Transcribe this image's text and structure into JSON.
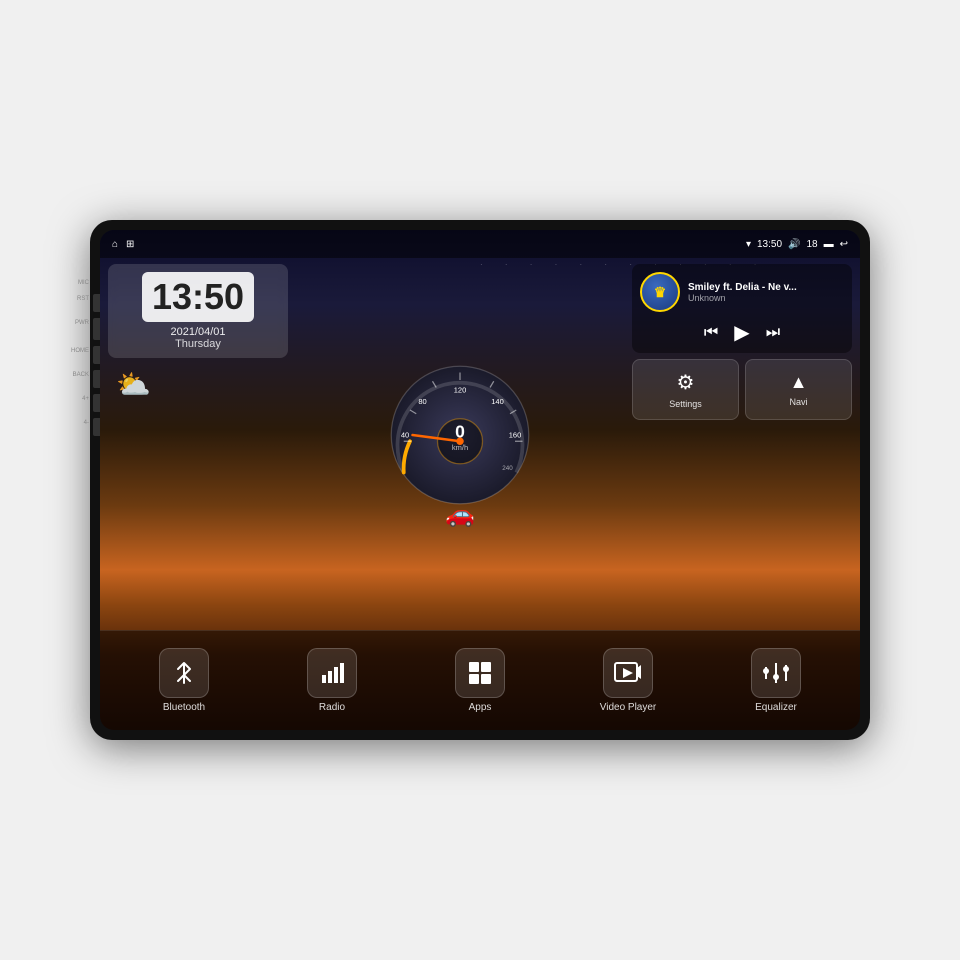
{
  "device": {
    "outer_bg": "#111"
  },
  "status_bar": {
    "wifi_icon": "wifi",
    "time": "13:50",
    "volume_icon": "volume",
    "volume_level": "18",
    "battery_icon": "battery",
    "back_icon": "back"
  },
  "nav_bar": {
    "home_icon": "⌂",
    "house_icon": "🏠"
  },
  "clock": {
    "time": "13:50",
    "date": "2021/04/01",
    "day": "Thursday"
  },
  "weather": {
    "icon": "⛅",
    "label": "Weather"
  },
  "speedometer": {
    "value": "0",
    "unit": "km/h",
    "max": "240"
  },
  "music": {
    "title": "Smiley ft. Delia - Ne v...",
    "artist": "Unknown",
    "prev_icon": "⏮",
    "play_icon": "▶",
    "next_icon": "⏭"
  },
  "quick_actions": [
    {
      "id": "settings",
      "icon": "⚙",
      "label": "Settings"
    },
    {
      "id": "navi",
      "icon": "▲",
      "label": "Navi"
    }
  ],
  "bottom_items": [
    {
      "id": "bluetooth",
      "icon": "bluetooth",
      "label": "Bluetooth"
    },
    {
      "id": "radio",
      "icon": "radio",
      "label": "Radio"
    },
    {
      "id": "apps",
      "icon": "apps",
      "label": "Apps"
    },
    {
      "id": "videoplayer",
      "icon": "video",
      "label": "Video Player"
    },
    {
      "id": "equalizer",
      "icon": "equalizer",
      "label": "Equalizer"
    }
  ],
  "side_buttons": [
    {
      "id": "mic",
      "label": "MIC"
    },
    {
      "id": "rst",
      "label": "RST"
    },
    {
      "id": "power",
      "label": "PWR"
    },
    {
      "id": "home",
      "label": "HOME"
    },
    {
      "id": "back",
      "label": "BACK"
    },
    {
      "id": "vol-up",
      "label": "4+"
    },
    {
      "id": "vol-down",
      "label": "4-"
    }
  ]
}
